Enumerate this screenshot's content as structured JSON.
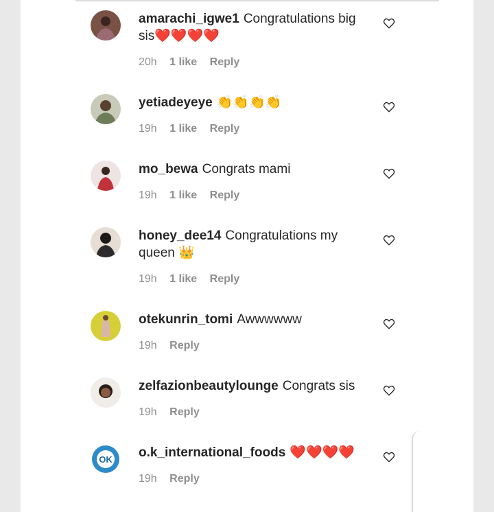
{
  "comments": [
    {
      "username": "amarachi_igwe1",
      "text": "Congratulations big sis❤️❤️❤️❤️",
      "time": "20h",
      "likes": "1 like",
      "reply": "Reply",
      "avatar_color": "#7a5145",
      "avatar_icon": "person-avatar"
    },
    {
      "username": "yetiadeyeye",
      "text": "👏👏👏👏",
      "time": "19h",
      "likes": "1 like",
      "reply": "Reply",
      "avatar_color": "#9aa38a",
      "avatar_icon": "person-avatar"
    },
    {
      "username": "mo_bewa",
      "text": "Congrats mami",
      "time": "19h",
      "likes": "1 like",
      "reply": "Reply",
      "avatar_color": "#e8dcdc",
      "avatar_icon": "person-avatar"
    },
    {
      "username": "honey_dee14",
      "text": "Congratulations my queen 👑",
      "time": "19h",
      "likes": "1 like",
      "reply": "Reply",
      "avatar_color": "#d9d0c6",
      "avatar_icon": "person-avatar"
    },
    {
      "username": "otekunrin_tomi",
      "text": "Awwwwww",
      "time": "19h",
      "likes": "",
      "reply": "Reply",
      "avatar_color": "#d7cf37",
      "avatar_icon": "person-avatar"
    },
    {
      "username": "zelfazionbeautylounge",
      "text": "Congrats sis",
      "time": "19h",
      "likes": "",
      "reply": "Reply",
      "avatar_color": "#f0ede8",
      "avatar_icon": "person-avatar"
    },
    {
      "username": "o.k_international_foods",
      "text": "❤️❤️❤️❤️",
      "time": "19h",
      "likes": "",
      "reply": "Reply",
      "avatar_color": "#2e8bc9",
      "avatar_icon": "logo-avatar",
      "logo_text": "OK"
    }
  ]
}
